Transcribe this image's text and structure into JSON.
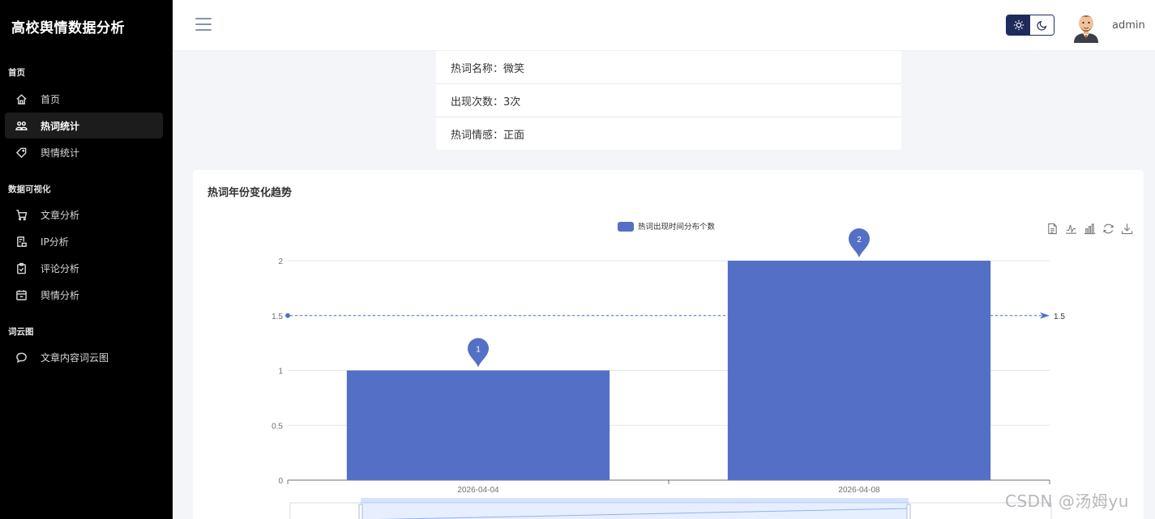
{
  "sidebar": {
    "brand": "高校舆情数据分析",
    "sections": [
      {
        "title": "首页",
        "items": [
          {
            "label": "首页",
            "icon": "home-icon"
          },
          {
            "label": "热词统计",
            "icon": "hot-words-icon",
            "active": true
          },
          {
            "label": "舆情统计",
            "icon": "tag-icon"
          }
        ]
      },
      {
        "title": "数据可视化",
        "items": [
          {
            "label": "文章分析",
            "icon": "cart-icon"
          },
          {
            "label": "IP分析",
            "icon": "ip-icon"
          },
          {
            "label": "评论分析",
            "icon": "clipboard-icon"
          },
          {
            "label": "舆情分析",
            "icon": "calendar-icon"
          }
        ]
      },
      {
        "title": "词云图",
        "items": [
          {
            "label": "文章内容词云图",
            "icon": "chat-icon"
          }
        ]
      }
    ]
  },
  "header": {
    "username": "admin",
    "theme": "light"
  },
  "info": {
    "name": "热词名称：微笑",
    "count": "出现次数：3次",
    "sentiment": "热词情感：正面"
  },
  "chart_title": "热词年份变化趋势",
  "chart_data": {
    "type": "bar",
    "categories": [
      "2026-04-04",
      "2026-04-08"
    ],
    "series": [
      {
        "name": "热词出现时间分布个数",
        "values": [
          1,
          2
        ],
        "color": "#5470c6"
      }
    ],
    "ylim": [
      0,
      2
    ],
    "yticks": [
      "0",
      "0.5",
      "1",
      "1.5",
      "2"
    ],
    "mark_points": [
      "1",
      "2"
    ],
    "mark_line": {
      "value": 1.5,
      "label": "1.5"
    },
    "legend_position": "top-center",
    "grid": true
  },
  "watermark": "CSDN @汤姆yu"
}
